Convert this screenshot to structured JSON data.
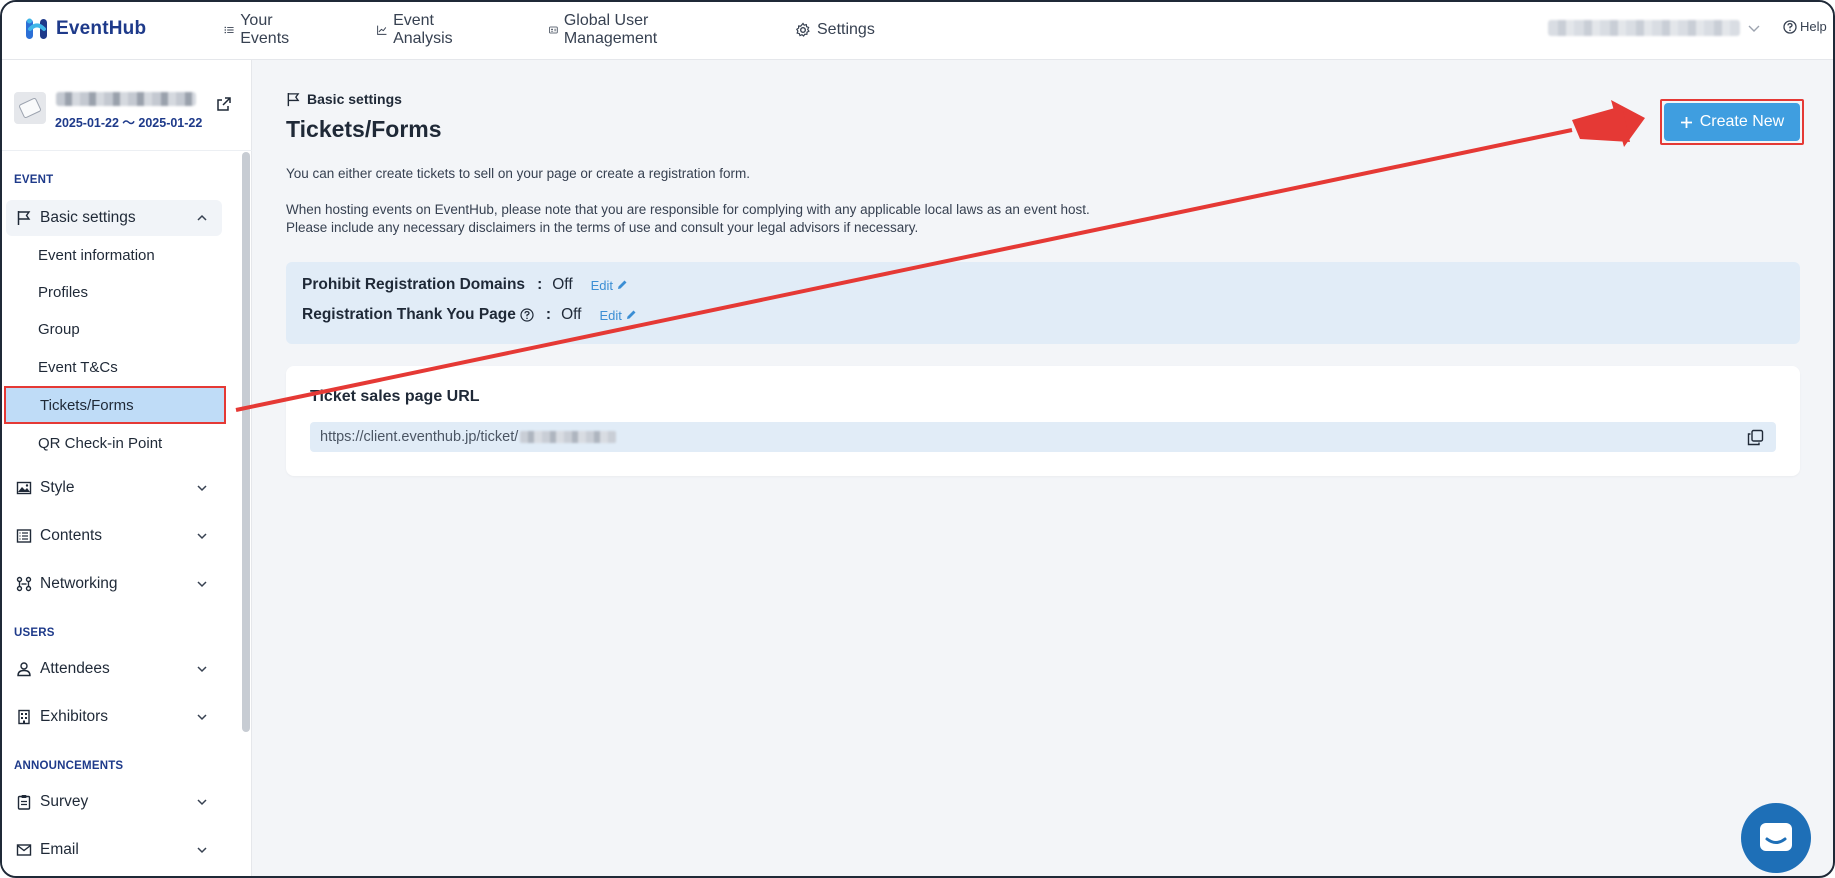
{
  "brand": {
    "name": "EventHub",
    "accent": "#3f9ee0",
    "annotation_color": "#e53935"
  },
  "nav": {
    "items": [
      {
        "label": "Your Events",
        "icon": "list-icon"
      },
      {
        "label": "Event Analysis",
        "icon": "chart-line-icon"
      },
      {
        "label": "Global User Management",
        "icon": "id-card-icon"
      },
      {
        "label": "Settings",
        "icon": "gear-icon"
      }
    ],
    "help": "Help"
  },
  "event": {
    "dates": "2025-01-22 〜 2025-01-22"
  },
  "sidebar": {
    "sections": {
      "event": "EVENT",
      "users": "USERS",
      "announcements": "ANNOUNCEMENTS"
    },
    "basic_settings": "Basic settings",
    "sub_items": [
      "Event information",
      "Profiles",
      "Group",
      "Event T&Cs",
      "Tickets/Forms",
      "QR Check-in Point"
    ],
    "groups": [
      "Style",
      "Contents",
      "Networking"
    ],
    "user_groups": [
      "Attendees",
      "Exhibitors"
    ],
    "announcement_groups": [
      "Survey",
      "Email"
    ]
  },
  "main": {
    "breadcrumb": "Basic settings",
    "title": "Tickets/Forms",
    "create_button": "Create New",
    "description": [
      "You can either create tickets to sell on your page or create a registration form.",
      "When hosting events on EventHub, please note that you are responsible for complying with any applicable local laws as an event host.",
      "Please include any necessary disclaimers in the terms of use and consult your legal advisors if necessary."
    ],
    "settings": [
      {
        "label": "Prohibit Registration Domains",
        "colon": ":",
        "value": "Off",
        "edit": "Edit"
      },
      {
        "label": "Registration Thank You Page",
        "colon": ":",
        "value": "Off",
        "edit": "Edit"
      }
    ],
    "url_card": {
      "title": "Ticket sales page URL",
      "url_prefix": "https://client.eventhub.jp/ticket/"
    }
  }
}
